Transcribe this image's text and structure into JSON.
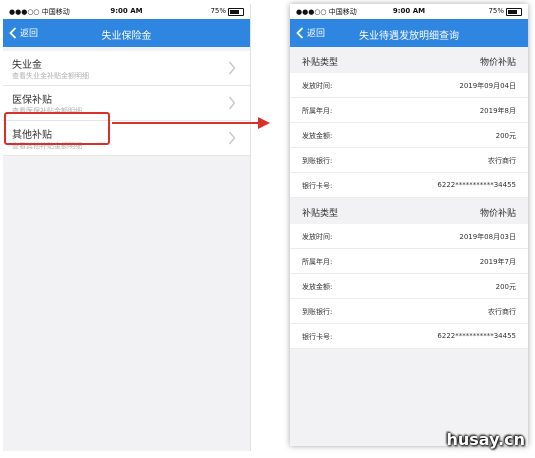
{
  "left": {
    "status": {
      "carrier": "●●●○○ 中国移动",
      "time": "9:00 AM",
      "battery": "75%"
    },
    "nav": {
      "back": "返回",
      "title": "失业保险金"
    },
    "items": [
      {
        "name": "失业金",
        "desc": "查看失业金补贴金额明细"
      },
      {
        "name": "医保补贴",
        "desc": "查看医保补贴金额明细"
      },
      {
        "name": "其他补贴",
        "desc": "查看其他补贴金额明细"
      }
    ]
  },
  "right": {
    "status": {
      "carrier": "●●●○○ 中国移动",
      "time": "9:00 AM",
      "battery": "75%"
    },
    "nav": {
      "back": "返回",
      "title": "失业待遇发放明细查询"
    },
    "records": [
      {
        "header": {
          "k": "补贴类型",
          "v": "物价补贴"
        },
        "rows": [
          {
            "k": "发放时间:",
            "v": "2019年09月04日"
          },
          {
            "k": "所属年月:",
            "v": "2019年8月"
          },
          {
            "k": "发放金额:",
            "v": "200元"
          },
          {
            "k": "到账银行:",
            "v": "农行商行"
          },
          {
            "k": "银行卡号:",
            "v": "6222***********34455"
          }
        ]
      },
      {
        "header": {
          "k": "补贴类型",
          "v": "物价补贴"
        },
        "rows": [
          {
            "k": "发放时间:",
            "v": "2019年08月03日"
          },
          {
            "k": "所属年月:",
            "v": "2019年7月"
          },
          {
            "k": "发放金额:",
            "v": "200元"
          },
          {
            "k": "到账银行:",
            "v": "农行商行"
          },
          {
            "k": "银行卡号:",
            "v": "6222***********34455"
          }
        ]
      }
    ]
  },
  "watermark": "husay.cn",
  "colors": {
    "navbar": "#2f86e0",
    "highlight": "#d9302a"
  }
}
